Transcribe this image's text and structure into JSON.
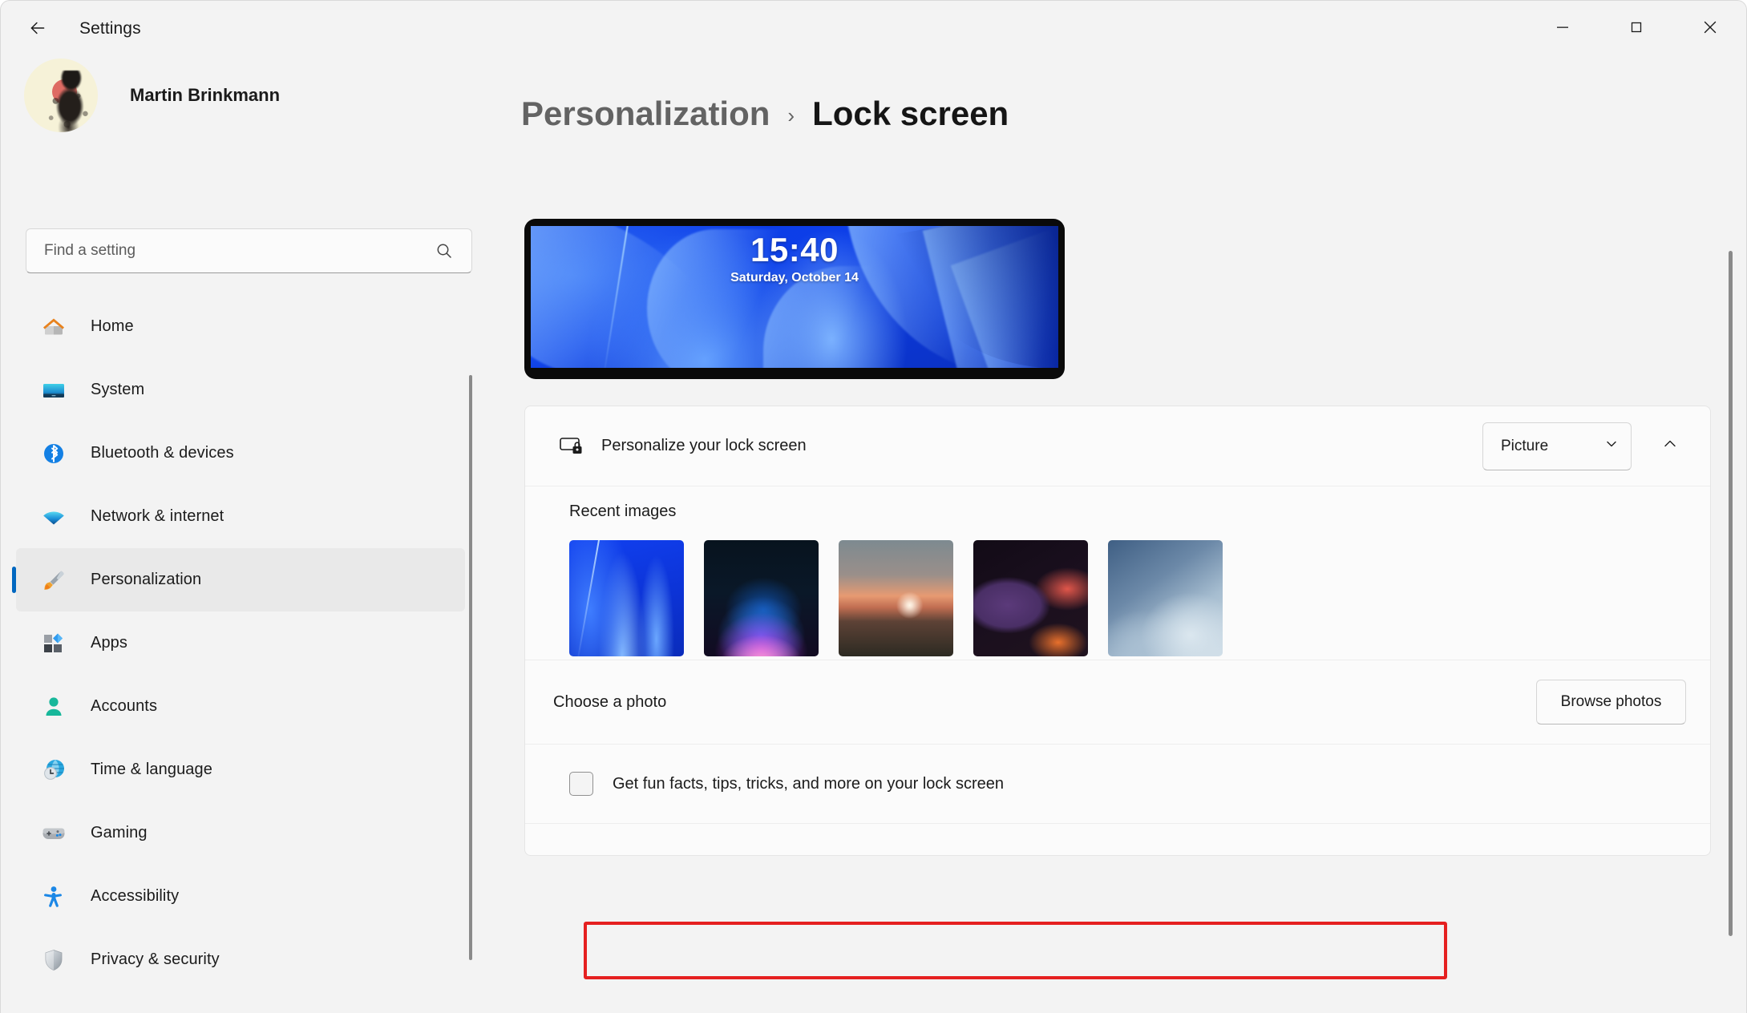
{
  "window": {
    "app_title": "Settings",
    "back_icon": "back-arrow-icon",
    "minimize_label": "—",
    "maximize_label": "□",
    "close_label": "✕"
  },
  "sidebar": {
    "profile": {
      "name": "Martin Brinkmann",
      "avatar_icon": "user-avatar"
    },
    "search": {
      "placeholder": "Find a setting",
      "value": "",
      "icon": "search-icon"
    },
    "items": [
      {
        "label": "Home",
        "icon": "home-icon",
        "active": false
      },
      {
        "label": "System",
        "icon": "system-monitor-icon",
        "active": false
      },
      {
        "label": "Bluetooth & devices",
        "icon": "bluetooth-icon",
        "active": false
      },
      {
        "label": "Network & internet",
        "icon": "wifi-icon",
        "active": false
      },
      {
        "label": "Personalization",
        "icon": "paintbrush-icon",
        "active": true
      },
      {
        "label": "Apps",
        "icon": "apps-icon",
        "active": false
      },
      {
        "label": "Accounts",
        "icon": "person-icon",
        "active": false
      },
      {
        "label": "Time & language",
        "icon": "clock-globe-icon",
        "active": false
      },
      {
        "label": "Gaming",
        "icon": "gamepad-icon",
        "active": false
      },
      {
        "label": "Accessibility",
        "icon": "accessibility-icon",
        "active": false
      },
      {
        "label": "Privacy & security",
        "icon": "shield-icon",
        "active": false
      }
    ]
  },
  "main": {
    "breadcrumb": {
      "parent": "Personalization",
      "separator": "›",
      "current": "Lock screen"
    },
    "preview": {
      "time": "15:40",
      "date": "Saturday, October 14"
    },
    "personalize_row": {
      "icon": "lock-screen-icon",
      "title": "Personalize your lock screen",
      "dropdown_value": "Picture",
      "dropdown_icon": "chevron-down-icon",
      "expander_icon": "chevron-up-icon"
    },
    "recent_images": {
      "label": "Recent images",
      "thumbnails": [
        {
          "name": "windows-bloom-blue"
        },
        {
          "name": "dark-gradient-orb"
        },
        {
          "name": "sunset-lake-landscape"
        },
        {
          "name": "purple-orange-abstract-flow"
        },
        {
          "name": "light-blue-ribbon-waves"
        }
      ]
    },
    "choose_photo_row": {
      "label": "Choose a photo",
      "button_label": "Browse photos"
    },
    "fun_facts_row": {
      "label": "Get fun facts, tips, tricks, and more on your lock screen",
      "checked": false
    }
  },
  "annotation": {
    "highlight_color": "#e52020",
    "target": "fun-facts-checkbox-row"
  }
}
